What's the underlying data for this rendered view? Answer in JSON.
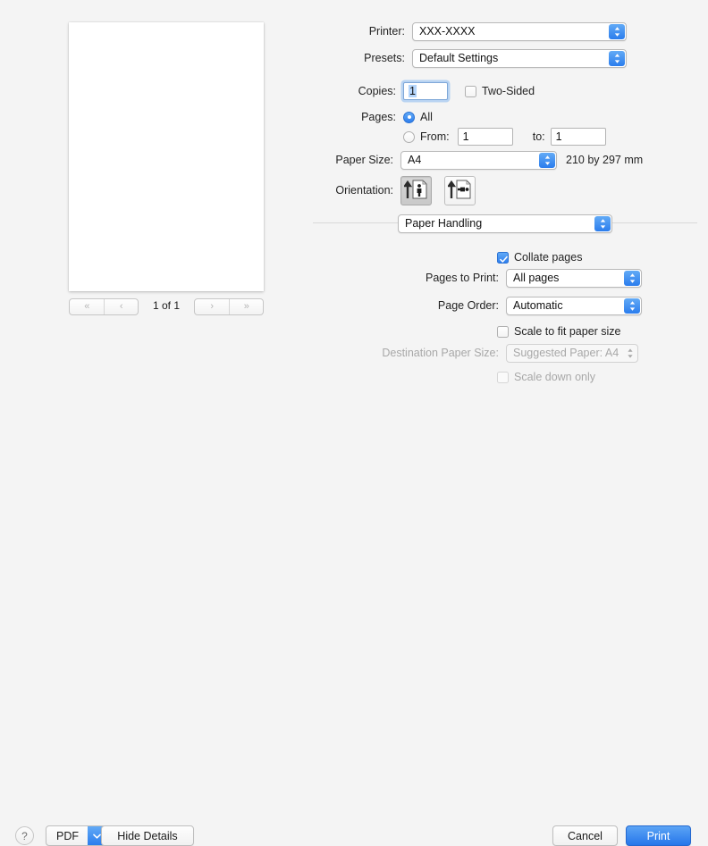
{
  "preview": {
    "page_indicator": "1 of 1",
    "nav": {
      "first_label": "«",
      "prev_label": "‹",
      "next_label": "›",
      "last_label": "»"
    }
  },
  "settings": {
    "printer": {
      "label": "Printer:",
      "value": "XXX-XXXX"
    },
    "presets": {
      "label": "Presets:",
      "value": "Default Settings"
    },
    "copies": {
      "label": "Copies:",
      "value": "1"
    },
    "two_sided": {
      "label": "Two-Sided",
      "checked": false
    },
    "pages": {
      "label": "Pages:",
      "all_label": "All",
      "from_label": "From:",
      "to_label": "to:",
      "from_value": "1",
      "to_value": "1",
      "selected": "all"
    },
    "paper_size": {
      "label": "Paper Size:",
      "value": "A4",
      "dimensions": "210 by 297 mm"
    },
    "orientation": {
      "label": "Orientation:",
      "portrait_name": "portrait",
      "landscape_name": "landscape",
      "selected": "portrait"
    },
    "pane_popup": {
      "value": "Paper Handling"
    },
    "collate": {
      "label": "Collate pages",
      "checked": true
    },
    "pages_to_print": {
      "label": "Pages to Print:",
      "value": "All pages"
    },
    "page_order": {
      "label": "Page Order:",
      "value": "Automatic"
    },
    "scale_to_fit": {
      "label": "Scale to fit paper size",
      "checked": false
    },
    "destination_paper_size": {
      "label": "Destination Paper Size:",
      "value": "Suggested Paper: A4",
      "disabled": true
    },
    "scale_down_only": {
      "label": "Scale down only",
      "checked": false,
      "disabled": true
    }
  },
  "footer": {
    "help_label": "?",
    "pdf_label": "PDF",
    "hide_details_label": "Hide Details",
    "cancel_label": "Cancel",
    "print_label": "Print"
  },
  "colors": {
    "accent": "#2b7ded",
    "window_bg": "#f4f4f4",
    "text": "#1a1a1a",
    "disabled_text": "#a8a8a8"
  }
}
